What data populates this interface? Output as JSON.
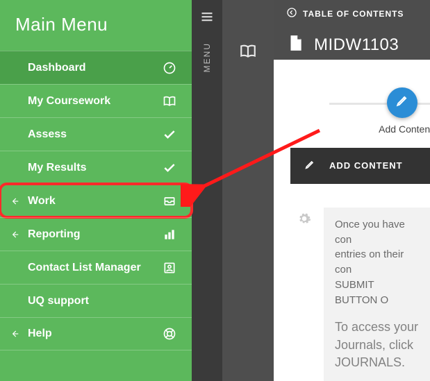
{
  "sidebar": {
    "title": "Main Menu",
    "items": [
      {
        "label": "Dashboard",
        "icon": "gauge-icon",
        "has_back": false,
        "active": true
      },
      {
        "label": "My Coursework",
        "icon": "book-open-icon",
        "has_back": false,
        "active": false
      },
      {
        "label": "Assess",
        "icon": "check-icon",
        "has_back": false,
        "active": false
      },
      {
        "label": "My Results",
        "icon": "check-icon",
        "has_back": false,
        "active": false
      },
      {
        "label": "Work",
        "icon": "tray-icon",
        "has_back": true,
        "active": false,
        "highlighted": true
      },
      {
        "label": "Reporting",
        "icon": "bar-chart-icon",
        "has_back": true,
        "active": false
      },
      {
        "label": "Contact List Manager",
        "icon": "contact-card-icon",
        "has_back": false,
        "active": false
      },
      {
        "label": "UQ support",
        "icon": null,
        "has_back": false,
        "active": false
      },
      {
        "label": "Help",
        "icon": "life-ring-icon",
        "has_back": true,
        "active": false
      }
    ]
  },
  "center_strip": {
    "menu_label": "MENU"
  },
  "header": {
    "toc_label": "TABLE OF CONTENTS",
    "doc_title": "MIDW1103"
  },
  "progress": {
    "add_caption": "Add Content"
  },
  "add_bar": {
    "label": "ADD CONTENT"
  },
  "note": {
    "line1": "Once you have con",
    "line2": "entries on their con",
    "line3": "SUBMIT BUTTON O",
    "line4": "To access your",
    "line5": "Journals, click",
    "line6": "JOURNALS."
  }
}
